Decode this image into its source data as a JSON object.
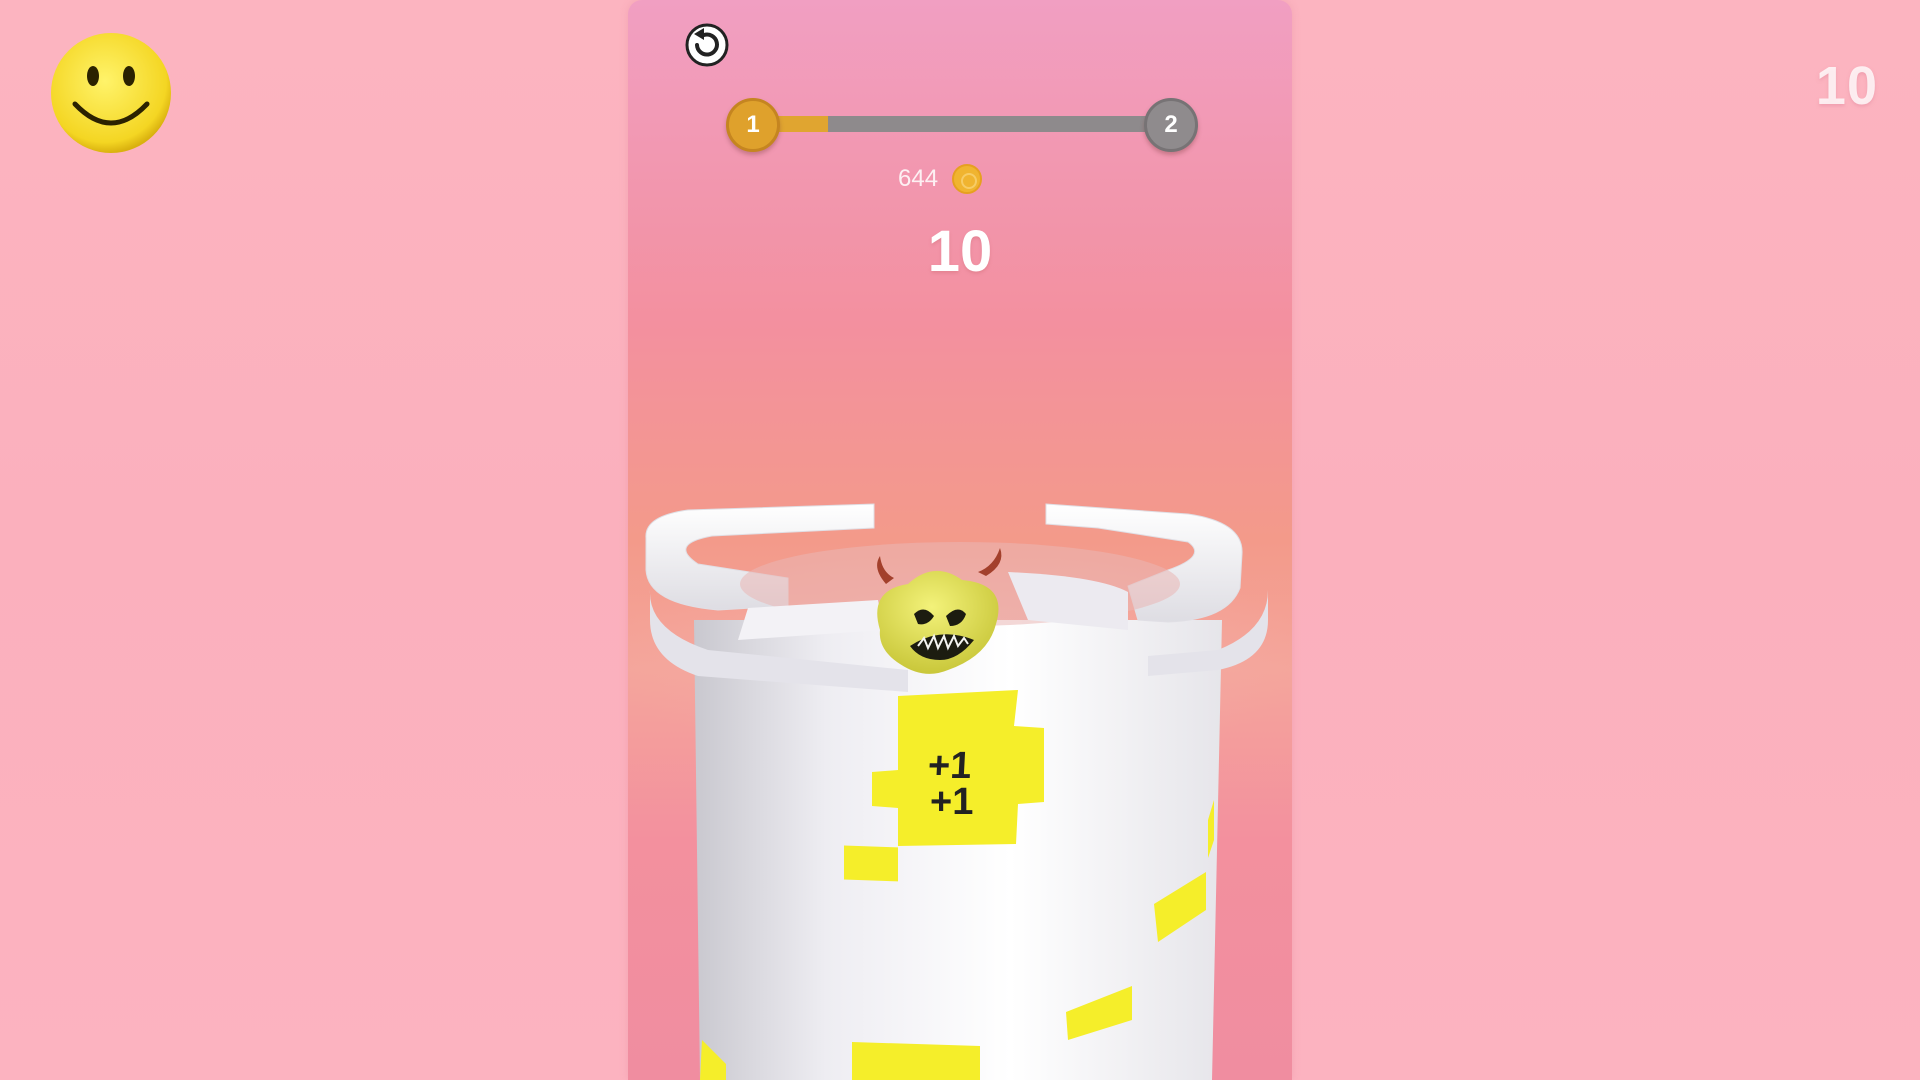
{
  "hud": {
    "corner_score": "10",
    "coin_count": "644",
    "score": "10",
    "plus_one": "+1",
    "plus_one_second": "+1"
  },
  "level": {
    "current": "1",
    "next": "2",
    "progress": 0.2
  },
  "icons": {
    "smiley": "smiley-face-icon",
    "restart": "restart-icon",
    "coin": "coin-icon"
  },
  "colors": {
    "background": "#fcb4c0",
    "panel_top": "#f19fc2",
    "panel_mid": "#f39a8a",
    "progress_fill": "#e0a530",
    "progress_track": "#8e8a8c",
    "tower": "#f4f3f6",
    "tile_yellow": "#f5ee2a",
    "ball_yellow": "#e6e354"
  }
}
